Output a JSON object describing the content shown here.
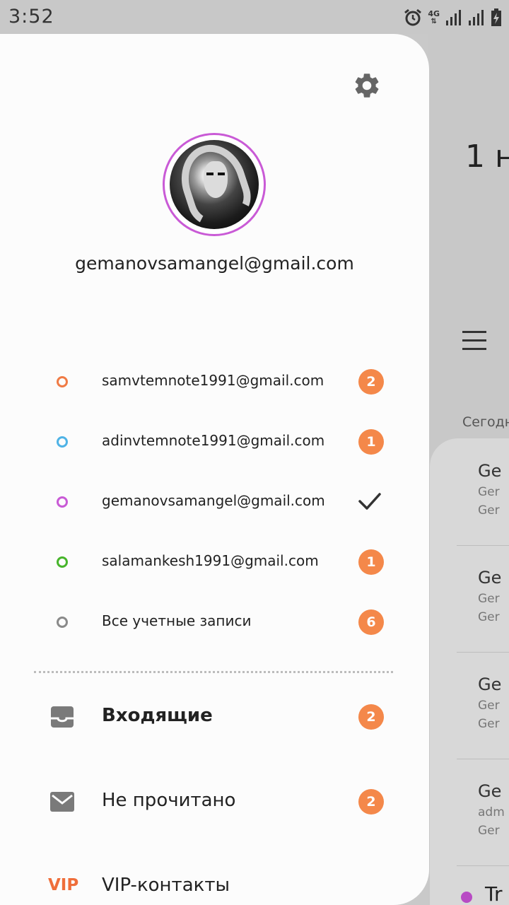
{
  "status_bar": {
    "time": "3:52",
    "network": "4G"
  },
  "drawer": {
    "settings_icon": "gear-icon",
    "profile": {
      "avatar_ring_color": "#c95ad6",
      "email": "gemanovsamangel@gmail.com"
    },
    "accounts": [
      {
        "email": "samvtemnote1991@gmail.com",
        "color": "#f07b45",
        "badge": "2",
        "selected": false
      },
      {
        "email": "adinvtemnote1991@gmail.com",
        "color": "#4fb3e6",
        "badge": "1",
        "selected": false
      },
      {
        "email": "gemanovsamangel@gmail.com",
        "color": "#c95ad6",
        "badge": "",
        "selected": true
      },
      {
        "email": "salamankesh1991@gmail.com",
        "color": "#47b52b",
        "badge": "1",
        "selected": false
      },
      {
        "email": "Все учетные записи",
        "color": "#8a8a8a",
        "badge": "6",
        "selected": false
      }
    ],
    "folders": [
      {
        "label": "Входящие",
        "icon": "inbox-icon",
        "badge": "2"
      },
      {
        "label": "Не прочитано",
        "icon": "envelope-icon",
        "badge": "2"
      },
      {
        "label": "VIP-контакты",
        "icon": "vip-icon",
        "icon_text": "VIP"
      }
    ]
  },
  "background": {
    "heading_partial": "1 н",
    "section_partial": "Сегодн",
    "items": [
      {
        "t1": "Ge",
        "t2": "Ger",
        "t3": "Ger"
      },
      {
        "t1": "Ge",
        "t2": "Ger",
        "t3": "Ger"
      },
      {
        "t1": "Ge",
        "t2": "Ger",
        "t3": "Ger"
      },
      {
        "t1": "Ge",
        "t2": "adm",
        "t3": "Ger"
      }
    ],
    "last_partial": "Tr"
  },
  "colors": {
    "badge": "#f4884a",
    "vip": "#ef6e3a",
    "drawer_bg": "#fcfcfc"
  }
}
